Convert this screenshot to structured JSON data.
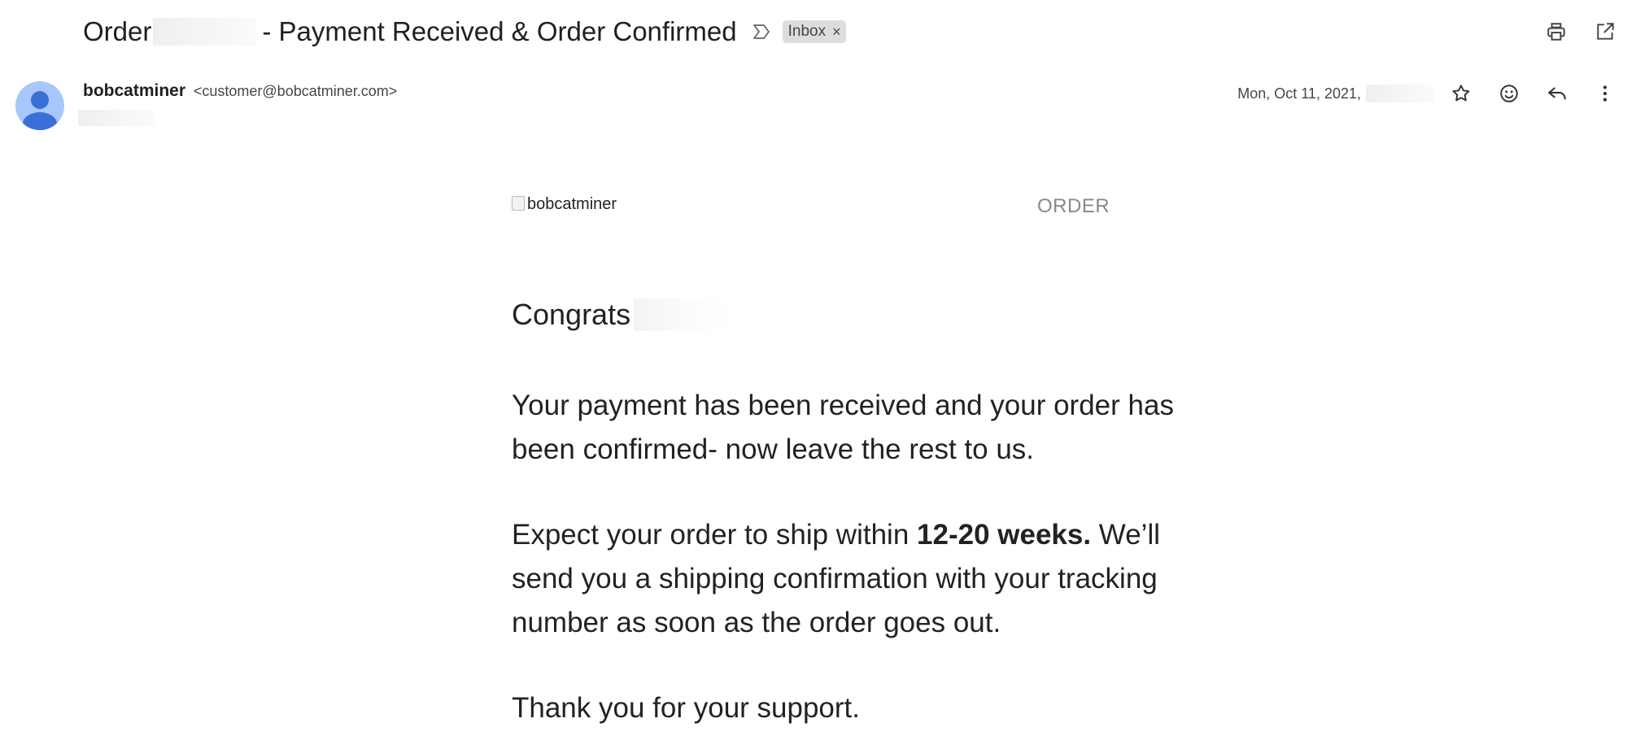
{
  "email": {
    "subject_prefix": "Order",
    "subject_suffix": "- Payment Received & Order Confirmed",
    "label": "Inbox",
    "label_remove": "×",
    "sender_name": "bobcatminer",
    "sender_email": "<customer@bobcatminer.com>",
    "date": "Mon, Oct 11, 2021,"
  },
  "body": {
    "logo_alt": "bobcatminer",
    "order_label": "ORDER",
    "greeting": "Congrats",
    "para1": "Your payment has been received and your order has been confirmed- now leave the rest to us.",
    "para2_before": "Expect your order to ship within ",
    "para2_bold": "12-20 weeks.",
    "para2_after": " We’ll send you a shipping confirmation with your tracking number as soon as the order goes out.",
    "para3": "Thank you for your support."
  },
  "icons": {
    "important": "label-important-icon",
    "print": "print-icon",
    "new_window": "open-in-new-window-icon",
    "star": "star-icon",
    "emoji": "add-reaction-icon",
    "reply": "reply-icon",
    "more": "more-vert-icon"
  },
  "colors": {
    "avatar_bg": "#a8c7fa",
    "avatar_fg": "#3b6fd8",
    "chip_bg": "#dddddd"
  }
}
